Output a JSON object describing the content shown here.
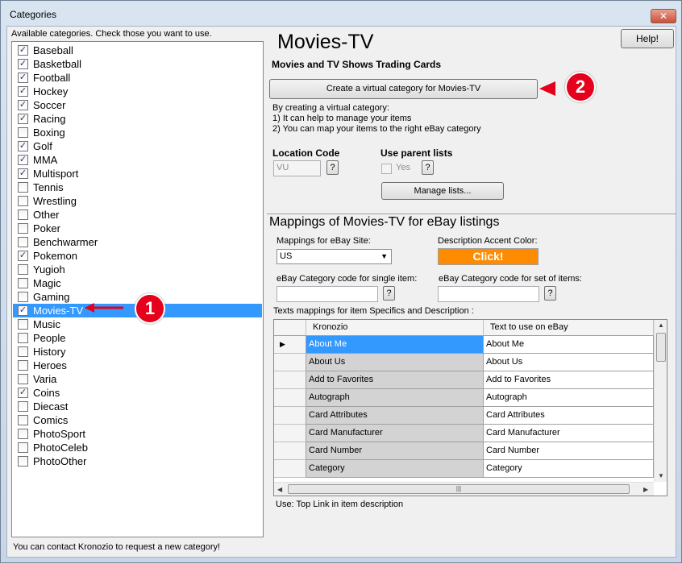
{
  "window": {
    "title": "Categories",
    "close_glyph": "✕"
  },
  "left": {
    "available_label": "Available categories. Check those you want to use.",
    "categories": [
      {
        "label": "Baseball",
        "checked": true
      },
      {
        "label": "Basketball",
        "checked": true
      },
      {
        "label": "Football",
        "checked": true
      },
      {
        "label": "Hockey",
        "checked": true
      },
      {
        "label": "Soccer",
        "checked": true
      },
      {
        "label": "Racing",
        "checked": true
      },
      {
        "label": "Boxing",
        "checked": false
      },
      {
        "label": "Golf",
        "checked": true
      },
      {
        "label": "MMA",
        "checked": true
      },
      {
        "label": "Multisport",
        "checked": true
      },
      {
        "label": "Tennis",
        "checked": false
      },
      {
        "label": "Wrestling",
        "checked": false
      },
      {
        "label": "Other",
        "checked": false
      },
      {
        "label": "Poker",
        "checked": false
      },
      {
        "label": "Benchwarmer",
        "checked": false
      },
      {
        "label": "Pokemon",
        "checked": true
      },
      {
        "label": "Yugioh",
        "checked": false
      },
      {
        "label": "Magic",
        "checked": false
      },
      {
        "label": "Gaming",
        "checked": false
      },
      {
        "label": "Movies-TV",
        "checked": true,
        "selected": true
      },
      {
        "label": "Music",
        "checked": false
      },
      {
        "label": "People",
        "checked": false
      },
      {
        "label": "History",
        "checked": false
      },
      {
        "label": "Heroes",
        "checked": false
      },
      {
        "label": "Varia",
        "checked": false
      },
      {
        "label": "Coins",
        "checked": true
      },
      {
        "label": "Diecast",
        "checked": false
      },
      {
        "label": "Comics",
        "checked": false
      },
      {
        "label": "PhotoSport",
        "checked": false
      },
      {
        "label": "PhotoCeleb",
        "checked": false
      },
      {
        "label": "PhotoOther",
        "checked": false
      }
    ],
    "status_text": "You can contact Kronozio to request a new category!"
  },
  "right": {
    "help_label": "Help!",
    "title": "Movies-TV",
    "subtitle": "Movies and TV Shows Trading Cards",
    "create_virtual_label": "Create a virtual category for Movies-TV",
    "info_lines": [
      "By creating a virtual category:",
      "1) It can help to manage your items",
      "2) You can map your items to the right eBay category"
    ],
    "location_code_label": "Location Code",
    "location_code_value": "VU",
    "use_parent_lists_label": "Use parent lists",
    "yes_label": "Yes",
    "yes_checked": false,
    "help_glyph": "?",
    "manage_lists_label": "Manage lists...",
    "mappings_title": "Mappings of Movies-TV for eBay listings",
    "mappings_site_label": "Mappings for eBay Site:",
    "mappings_site_value": "US",
    "accent_label": "Description Accent Color:",
    "accent_button": "Click!",
    "accent_color": "#ff8c00",
    "single_item_label": "eBay Category code for single item:",
    "set_items_label": "eBay Category code for set of items:",
    "texts_mappings_label": "Texts mappings for item Specifics and Description :",
    "grid": {
      "columns": [
        "Kronozio",
        "Text to use on eBay"
      ],
      "rows": [
        [
          "About Me",
          "About Me"
        ],
        [
          "About Us",
          "About Us"
        ],
        [
          "Add to Favorites",
          "Add to Favorites"
        ],
        [
          "Autograph",
          "Autograph"
        ],
        [
          "Card Attributes",
          "Card Attributes"
        ],
        [
          "Card Manufacturer",
          "Card Manufacturer"
        ],
        [
          "Card Number",
          "Card Number"
        ],
        [
          "Category",
          "Category"
        ]
      ]
    },
    "use_text": "Use: Top Link in item description"
  },
  "markers": {
    "one": "1",
    "two": "2",
    "color": "#e5001c"
  }
}
